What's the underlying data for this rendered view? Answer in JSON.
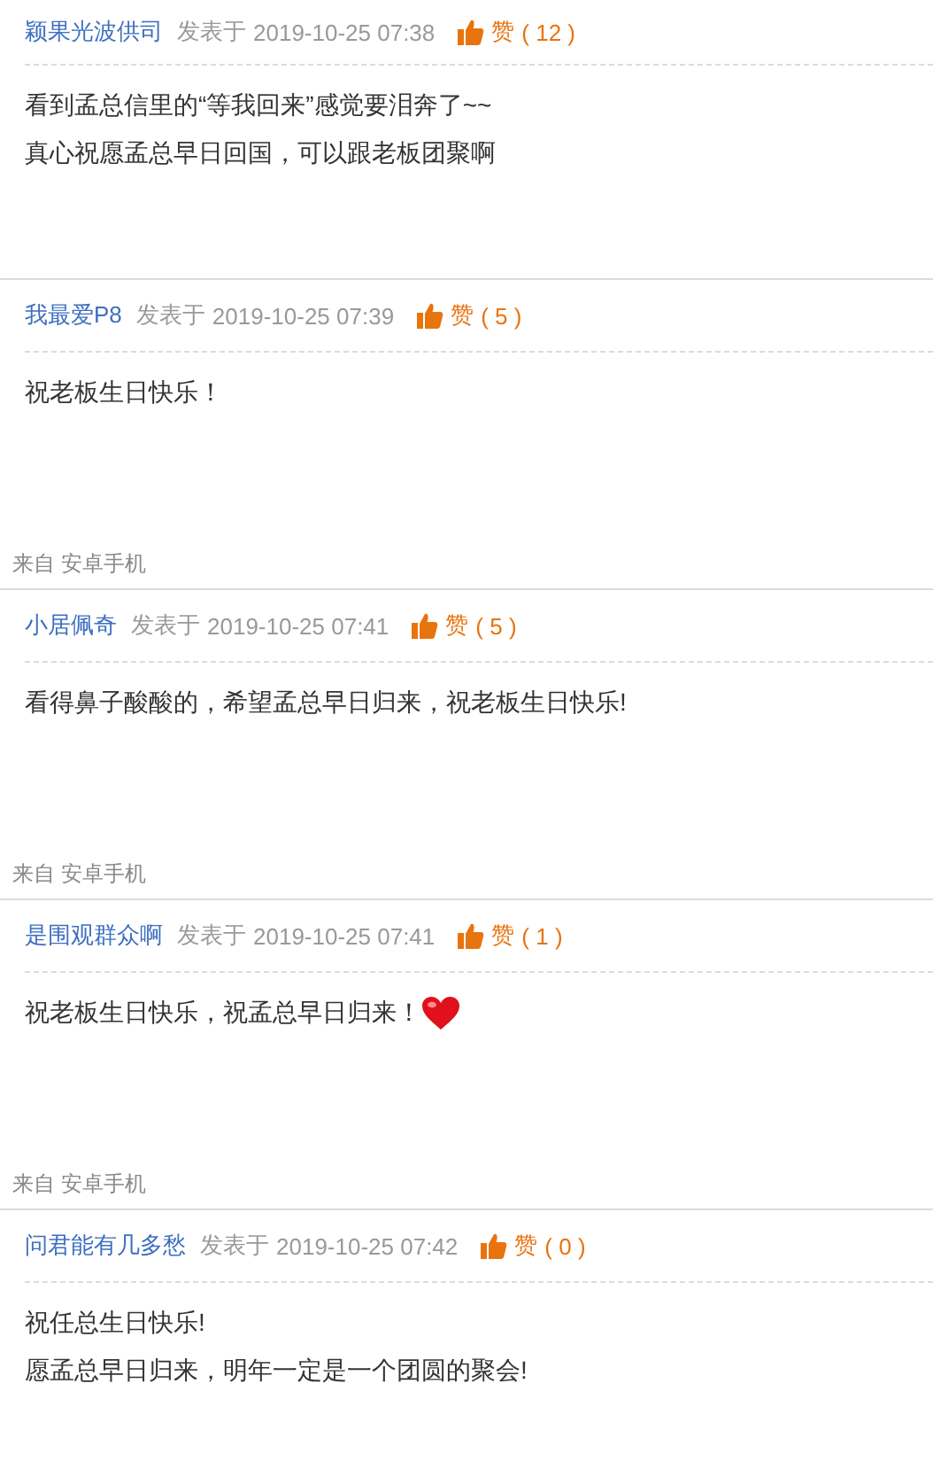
{
  "posts": [
    {
      "author": "颖果光波供司",
      "posted_label": "发表于",
      "time": "2019-10-25 07:38",
      "like_label": "赞",
      "like_count": "( 12 )",
      "lines": [
        "看到孟总信里的“等我回来”感觉要泪奔了~~",
        "真心祝愿孟总早日回国，可以跟老板团聚啊"
      ],
      "heart": false
    },
    {
      "author": "我最爱P8",
      "posted_label": "发表于",
      "time": "2019-10-25 07:39",
      "like_label": "赞",
      "like_count": "( 5 )",
      "lines": [
        "祝老板生日快乐！"
      ],
      "heart": false,
      "source": "来自 安卓手机"
    },
    {
      "author": "小居佩奇",
      "posted_label": "发表于",
      "time": "2019-10-25 07:41",
      "like_label": "赞",
      "like_count": "( 5 )",
      "lines": [
        "看得鼻子酸酸的，希望孟总早日归来，祝老板生日快乐!"
      ],
      "heart": false,
      "source": "来自 安卓手机"
    },
    {
      "author": "是围观群众啊",
      "posted_label": "发表于",
      "time": "2019-10-25 07:41",
      "like_label": "赞",
      "like_count": "( 1 )",
      "lines": [
        "祝老板生日快乐，祝孟总早日归来！"
      ],
      "heart": true,
      "source": "来自 安卓手机"
    },
    {
      "author": "问君能有几多愁",
      "posted_label": "发表于",
      "time": "2019-10-25 07:42",
      "like_label": "赞",
      "like_count": "( 0 )",
      "lines": [
        "祝任总生日快乐!",
        "愿孟总早日归来，明年一定是一个团圆的聚会!"
      ],
      "heart": false
    }
  ]
}
